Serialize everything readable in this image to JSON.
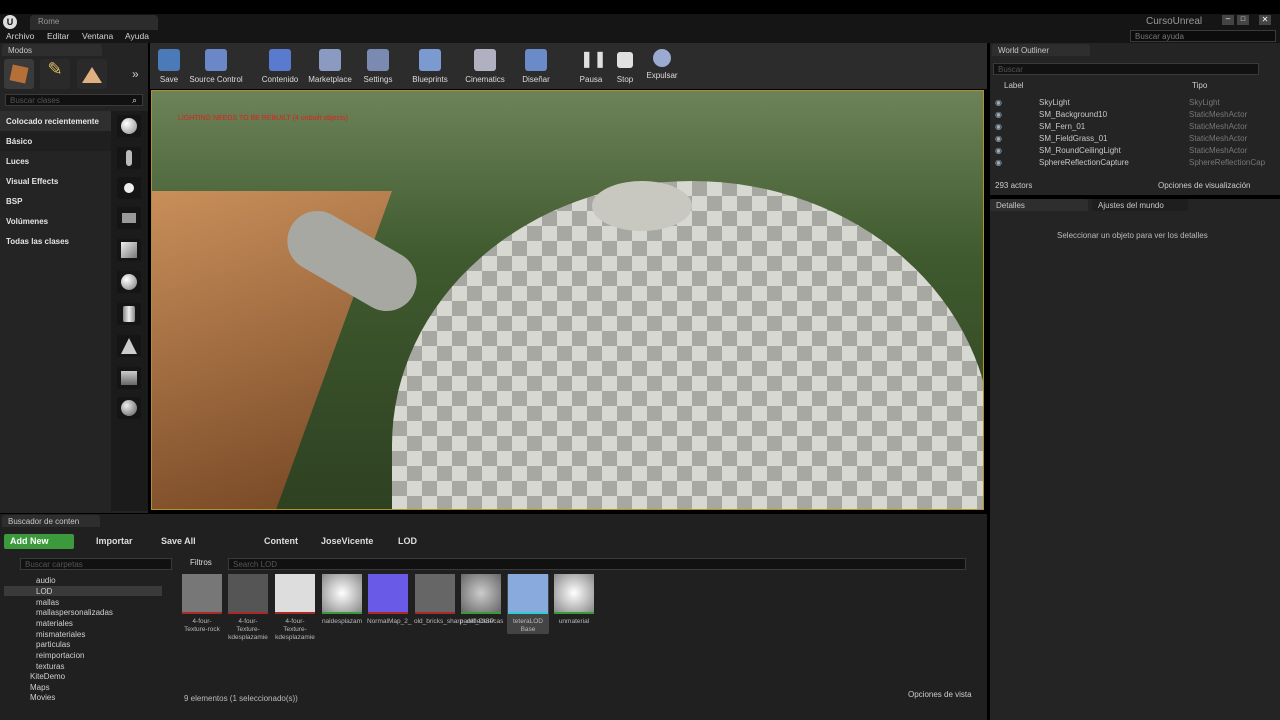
{
  "window": {
    "tab_title": "Rome",
    "project_name": "CursoUnreal",
    "help_search_placeholder": "Buscar ayuda"
  },
  "menu": [
    "Archivo",
    "Editar",
    "Ventana",
    "Ayuda"
  ],
  "modes": {
    "tab_label": "Modos",
    "search_placeholder": "Buscar clases",
    "categories": [
      "Colocado recientemente",
      "Básico",
      "Luces",
      "Visual Effects",
      "BSP",
      "Volúmenes",
      "Todas las clases"
    ]
  },
  "toolbar": [
    "Save",
    "Source Control",
    "Contenido",
    "Marketplace",
    "Settings",
    "Blueprints",
    "Cinematics",
    "Diseñar",
    "Pausa",
    "Stop",
    "Expulsar"
  ],
  "viewport": {
    "warning": "LIGHTING NEEDS TO BE REBUILT (4 unbuilt objects)"
  },
  "outliner": {
    "tab_label": "World Outliner",
    "search_placeholder": "Buscar",
    "col_label": "Label",
    "col_type": "Tipo",
    "rows": [
      {
        "name": "SkyLight",
        "type": "SkyLight"
      },
      {
        "name": "SM_Background10",
        "type": "StaticMeshActor"
      },
      {
        "name": "SM_Fern_01",
        "type": "StaticMeshActor"
      },
      {
        "name": "SM_FieldGrass_01",
        "type": "StaticMeshActor"
      },
      {
        "name": "SM_RoundCeilingLight",
        "type": "StaticMeshActor"
      },
      {
        "name": "SphereReflectionCapture",
        "type": "SphereReflectionCap"
      }
    ],
    "count": "293 actors",
    "view_options": "Opciones de visualización"
  },
  "details": {
    "tab_label": "Detalles",
    "world_tab": "Ajustes del mundo",
    "empty_text": "Seleccionar un objeto para ver los detalles"
  },
  "content_browser": {
    "tab_label": "Buscador de conten",
    "add_new": "Add New",
    "import": "Importar",
    "save_all": "Save All",
    "breadcrumb": [
      "Content",
      "JoseVicente",
      "LOD"
    ],
    "folder_search": "Buscar carpetas",
    "filters": "Filtros",
    "asset_search": "Search LOD",
    "folders": [
      "audio",
      "LOD",
      "mallas",
      "mallaspersonalizadas",
      "materiales",
      "mismateriales",
      "particulas",
      "reimportacion",
      "texturas"
    ],
    "root_folders": [
      "KiteDemo",
      "Maps",
      "Movies"
    ],
    "assets": [
      "4-four-Texture-rock",
      "4-four-Texture-kdesplazamie",
      "4-four-Texture-kdesplazamie",
      "naldesplazam",
      "NormalMap_2_",
      "old_bricks_sharp_diff_DISP",
      "paredederocas",
      "teteraLOD Base",
      "unmaterial"
    ],
    "status": "9 elementos (1 seleccionado(s))",
    "view_options": "Opciones de vista"
  }
}
